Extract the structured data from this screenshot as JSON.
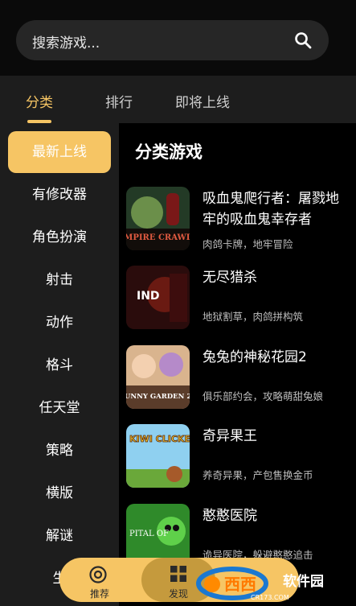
{
  "search": {
    "placeholder": "搜索游戏...",
    "icon": "search-icon"
  },
  "tabs": [
    {
      "label": "分类",
      "active": true
    },
    {
      "label": "排行",
      "active": false
    },
    {
      "label": "即将上线",
      "active": false
    }
  ],
  "sidebar": {
    "items": [
      {
        "label": "最新上线",
        "active": true
      },
      {
        "label": "有修改器"
      },
      {
        "label": "角色扮演"
      },
      {
        "label": "射击"
      },
      {
        "label": "动作"
      },
      {
        "label": "格斗"
      },
      {
        "label": "任天堂"
      },
      {
        "label": "策略"
      },
      {
        "label": "横版"
      },
      {
        "label": "解谜"
      },
      {
        "label": "生"
      }
    ]
  },
  "main": {
    "title": "分类游戏",
    "games": [
      {
        "name": "吸血鬼爬行者：屠戮地牢的吸血鬼幸存者",
        "desc": "肉鸽卡牌，地牢冒险",
        "thumb_text": "MPIRE CRAWL",
        "thumb_color": "#2f4a2a"
      },
      {
        "name": "无尽猎杀",
        "desc": "地狱割草，肉鸽拼构筑",
        "thumb_text": "IND",
        "thumb_color": "#4a1414"
      },
      {
        "name": "兔兔的神秘花园2",
        "desc": "俱乐部约会，攻略萌甜兔娘",
        "thumb_text": "BUNNY GARDEN 2",
        "thumb_color": "#c89a7a"
      },
      {
        "name": "奇异果王",
        "desc": "养奇异果，产包售换金币",
        "thumb_text": "KIWI CLICKER",
        "thumb_color": "#8fd0f0"
      },
      {
        "name": "憨憨医院",
        "desc": "诡异医院，躲避憨憨追击",
        "thumb_text": "PITAL OF",
        "thumb_color": "#2f8a2a"
      }
    ]
  },
  "bottom_nav": [
    {
      "label": "推荐",
      "icon": "target-icon",
      "active": false
    },
    {
      "label": "发现",
      "icon": "grid-icon",
      "active": true
    }
  ],
  "watermark": {
    "text": "软件园",
    "brand": "西西",
    "sub": "CR173.COM"
  },
  "colors": {
    "accent": "#f6c564",
    "panel": "#1d1d1d",
    "background": "#000000"
  }
}
